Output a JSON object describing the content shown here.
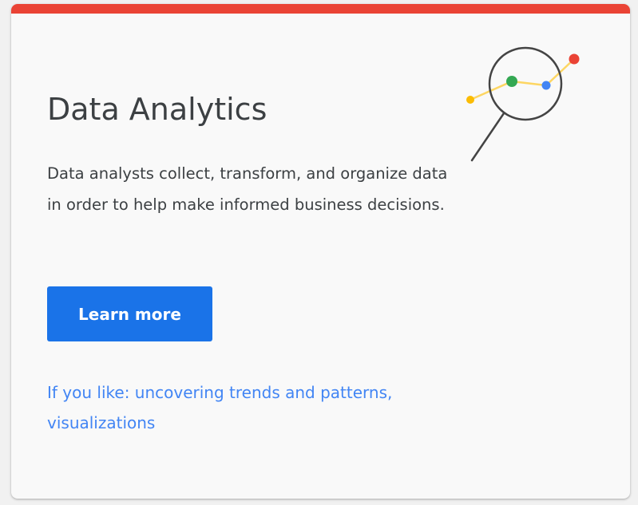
{
  "card": {
    "title": "Data Analytics",
    "description": "Data analysts collect, transform, and organize data in order to help make informed business decisions.",
    "button_label": "Learn more",
    "interests_text": "If you like: uncovering trends and patterns, visualizations"
  },
  "illustration": {
    "icon": "magnifier-line-chart-icon"
  },
  "colors": {
    "accent_bar": "#ea4335",
    "button_bg": "#1a73e8",
    "link_text": "#4285f4",
    "point_yellow": "#fbbc04",
    "point_green": "#34a853",
    "point_blue": "#4285f4",
    "point_red": "#ea4335",
    "trend_line": "#fdd663",
    "magnifier": "#444444"
  }
}
